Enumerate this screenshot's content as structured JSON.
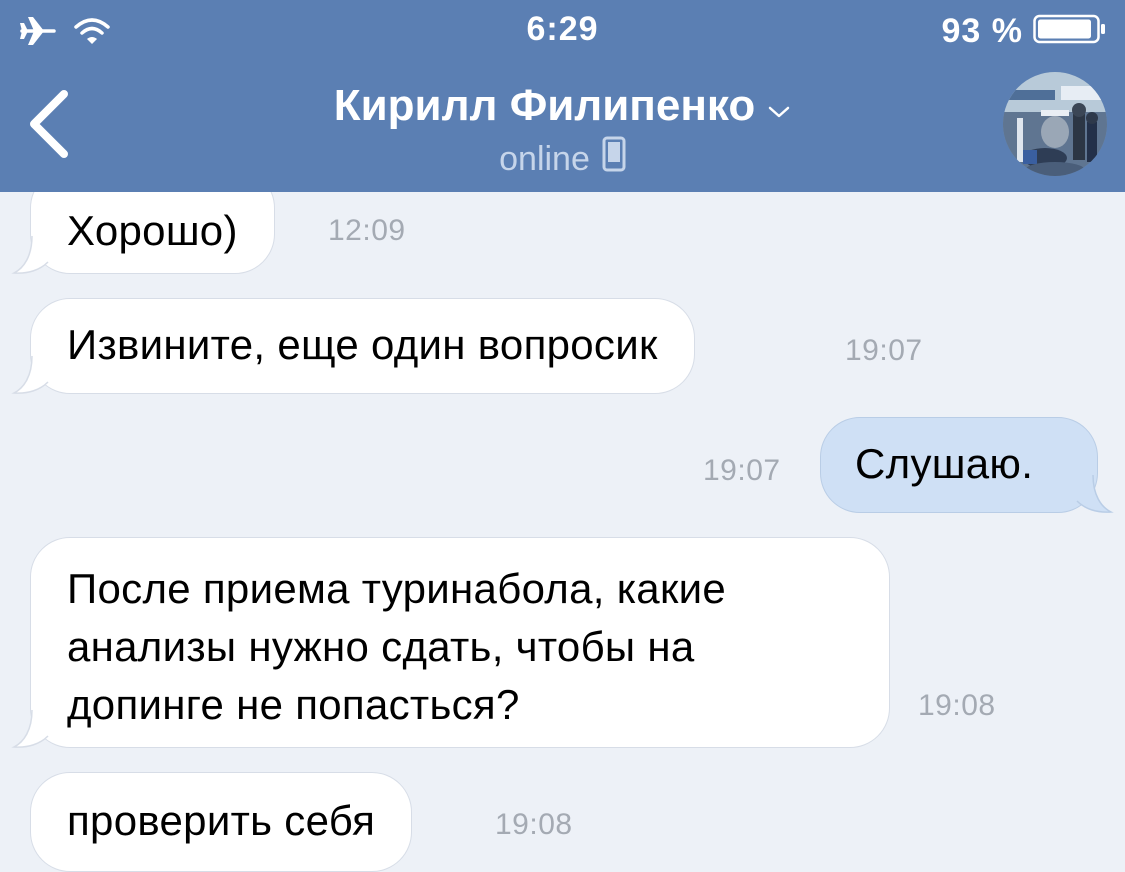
{
  "status_bar": {
    "time": "6:29",
    "battery_percent": "93 %",
    "battery_level": 0.93,
    "icons": [
      "airplane-icon",
      "wifi-icon",
      "battery-icon"
    ]
  },
  "header": {
    "title": "Кирилл Филипенко",
    "subtitle": "online",
    "icons": [
      "back-chevron-icon",
      "chevron-down-icon",
      "mobile-phone-icon",
      "avatar-photo"
    ]
  },
  "messages": [
    {
      "direction": "incoming",
      "text": "Хорошо)",
      "time": "12:09"
    },
    {
      "direction": "incoming",
      "text": "Извините, еще один вопросик",
      "time": "19:07"
    },
    {
      "direction": "outgoing",
      "text": "Слушаю.",
      "time": "19:07"
    },
    {
      "direction": "incoming",
      "lines": [
        "После приема туринабола, какие",
        "анализы нужно сдать, чтобы на",
        "допинге не попасться?"
      ],
      "time": "19:08"
    },
    {
      "direction": "incoming",
      "text": "проверить себя",
      "time": "19:08"
    }
  ],
  "colors": {
    "header_bg": "#5b7fb3",
    "chat_bg": "#edf1f7",
    "incoming_bubble": "#ffffff",
    "outgoing_bubble": "#cfe0f5",
    "timestamp": "#a4aab3"
  }
}
